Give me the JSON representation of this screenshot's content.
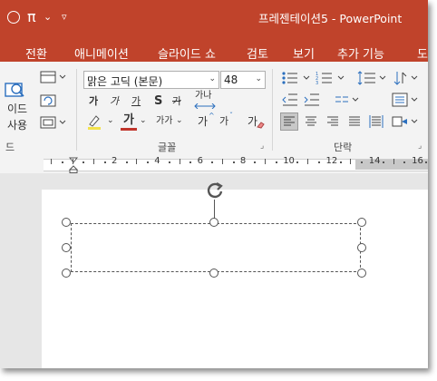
{
  "window": {
    "title": "프레젠테이션5 - PowerPoint"
  },
  "quick_access": {
    "pi_symbol": "π",
    "caret": "⌄",
    "customize": "▿"
  },
  "tabs": [
    "전환",
    "애니메이션",
    "슬라이드 쇼",
    "검토",
    "보기",
    "추가 기능",
    "도"
  ],
  "ribbon": {
    "slides_group": {
      "partial_label_1": "이드",
      "partial_label_2": "사용",
      "group_label": "드"
    },
    "font_group": {
      "font_name": "맑은 고딕 (본문)",
      "font_size": "48",
      "bold": "가",
      "italic": "가",
      "underline": "가",
      "shadow": "S",
      "strikethrough": "가",
      "char_spacing": "가나",
      "font_color": "가",
      "change_case": "가가",
      "grow": "가",
      "shrink": "가",
      "clear": "가",
      "group_label": "글꼴",
      "font_color_hex": "#c0352b",
      "highlight_hex": "#f3e24b"
    },
    "paragraph_group": {
      "group_label": "단락"
    }
  },
  "ruler": {
    "labels": [
      "2",
      "4",
      "6",
      "8",
      "10",
      "12",
      "14",
      "16"
    ]
  },
  "colors": {
    "accent": "#c0432b",
    "ribbon_bg": "#f3f3f3",
    "canvas_bg": "#e6e6e6"
  }
}
